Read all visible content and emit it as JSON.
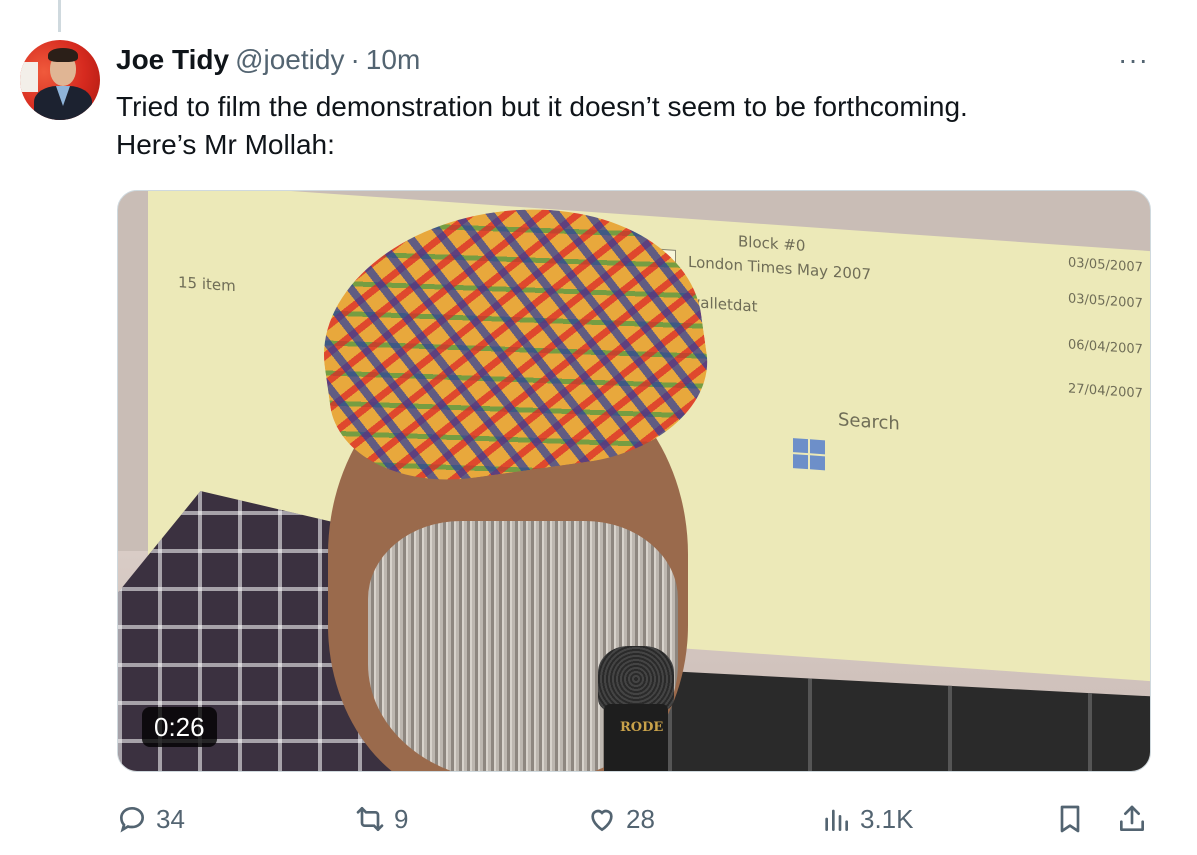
{
  "tweet": {
    "author_name": "Joe Tidy",
    "handle": "@joetidy",
    "separator": "·",
    "timestamp": "10m",
    "more_label": "···",
    "text_line1": "Tried to film the demonstration but it doesn’t seem to be forthcoming.",
    "text_line2": "Here’s Mr Mollah:"
  },
  "media": {
    "duration": "0:26",
    "screen": {
      "items_count": "15 item",
      "file_top": "Block #0",
      "file1": "London Times May 2007",
      "file2": "walletdat",
      "date1": "03/05/2007",
      "date2": "03/05/2007",
      "date3": "06/04/2007",
      "date4": "27/04/2007",
      "search": "Search"
    },
    "mic_label": "RODE"
  },
  "actions": {
    "replies": "34",
    "reposts": "9",
    "likes": "28",
    "views": "3.1K"
  },
  "icons": {
    "reply": "reply-icon",
    "repost": "repost-icon",
    "like": "heart-icon",
    "views": "views-icon",
    "bookmark": "bookmark-icon",
    "share": "share-icon"
  }
}
